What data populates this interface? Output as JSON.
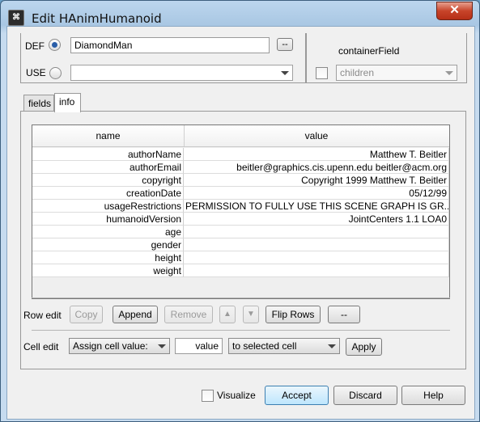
{
  "window": {
    "title": "Edit HAnimHumanoid",
    "close_glyph": "✕",
    "app_icon_glyph": "⌘"
  },
  "def_use": {
    "def_label": "DEF",
    "def_value": "DiamondMan",
    "def_button_label": "--",
    "use_label": "USE",
    "use_value": ""
  },
  "container_field": {
    "label": "containerField",
    "value": "children"
  },
  "tabs": [
    {
      "label": "fields",
      "active": false
    },
    {
      "label": "info",
      "active": true
    }
  ],
  "table": {
    "columns": [
      "name",
      "value"
    ],
    "rows": [
      {
        "name": "authorName",
        "value": "Matthew T. Beitler"
      },
      {
        "name": "authorEmail",
        "value": "beitler@graphics.cis.upenn.edu beitler@acm.org"
      },
      {
        "name": "copyright",
        "value": "Copyright 1999 Matthew T. Beitler"
      },
      {
        "name": "creationDate",
        "value": "05/12/99"
      },
      {
        "name": "usageRestrictions",
        "value": "PERMISSION TO FULLY USE THIS SCENE GRAPH IS GR..."
      },
      {
        "name": "humanoidVersion",
        "value": "JointCenters 1.1 LOA0"
      },
      {
        "name": "age",
        "value": ""
      },
      {
        "name": "gender",
        "value": ""
      },
      {
        "name": "height",
        "value": ""
      },
      {
        "name": "weight",
        "value": ""
      }
    ]
  },
  "row_edit": {
    "label": "Row edit",
    "copy": "Copy",
    "append": "Append",
    "remove": "Remove",
    "up_glyph": "▲",
    "down_glyph": "▼",
    "flip": "Flip Rows",
    "more": "--"
  },
  "cell_edit": {
    "label": "Cell edit",
    "assign_option": "Assign cell value:",
    "value": "value",
    "target_option": "to selected cell",
    "apply": "Apply"
  },
  "footer": {
    "visualize": "Visualize",
    "accept": "Accept",
    "discard": "Discard",
    "help": "Help"
  }
}
